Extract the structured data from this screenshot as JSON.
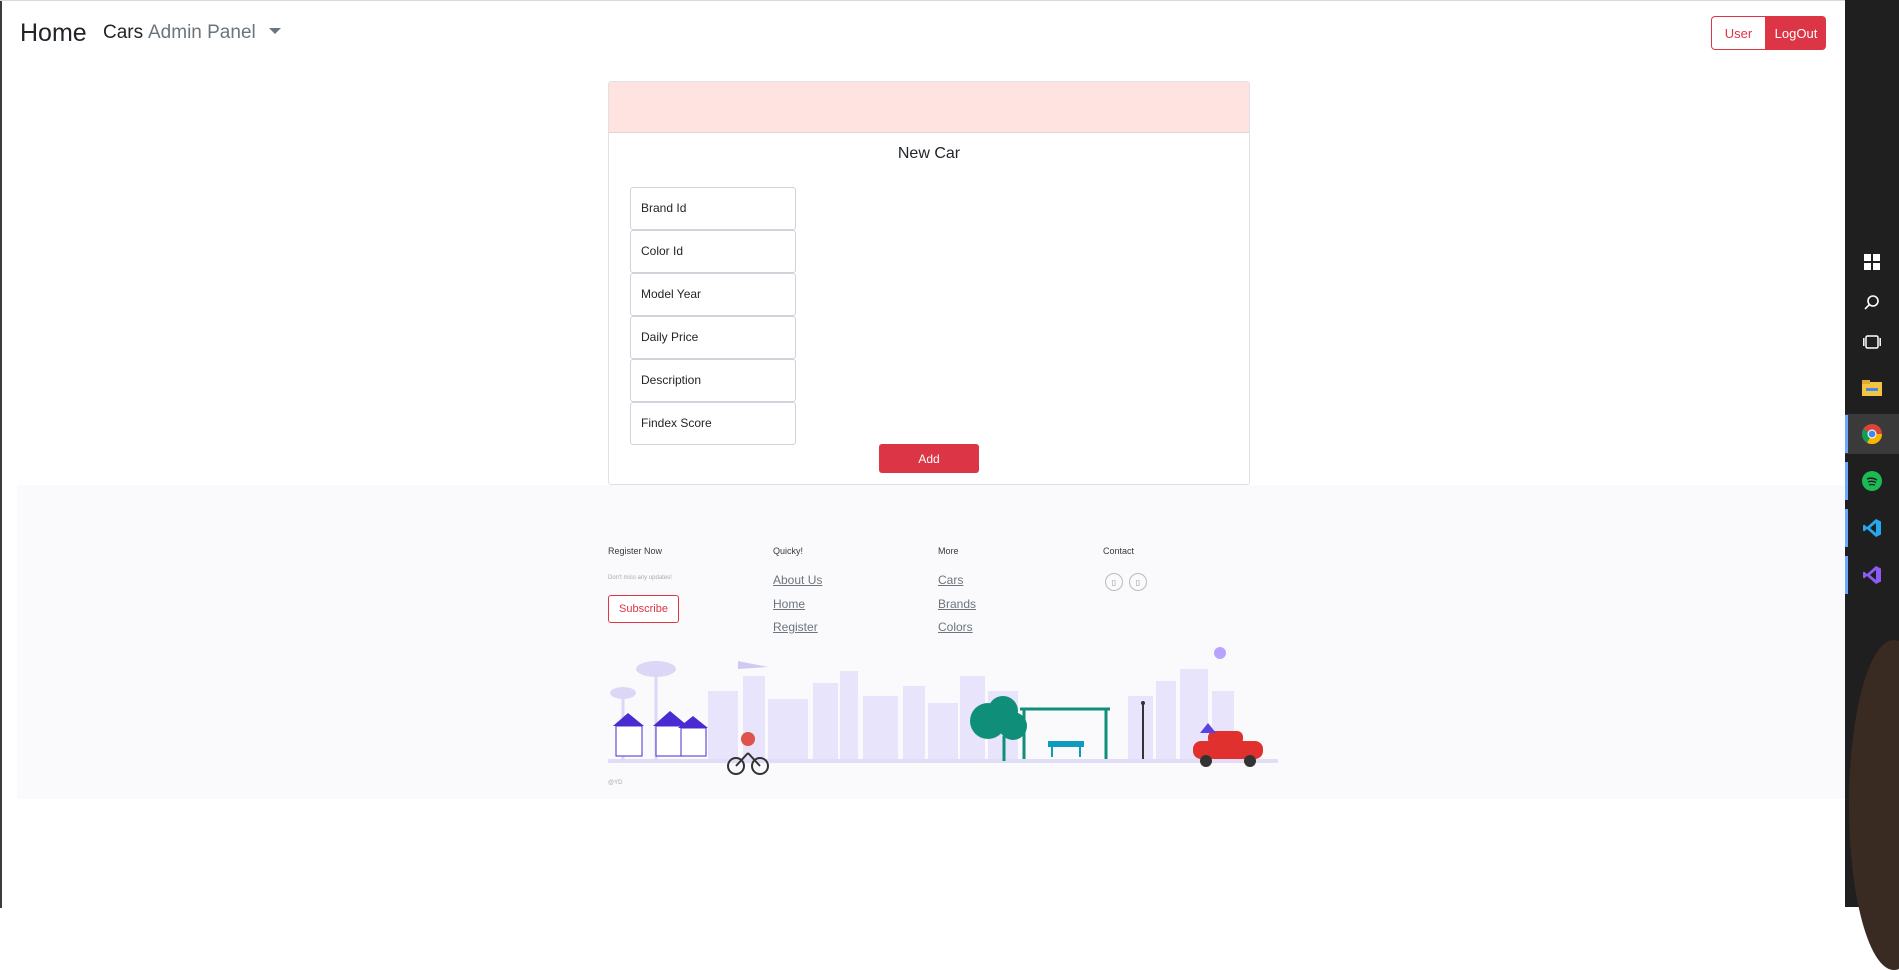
{
  "navbar": {
    "brand": "Home",
    "cars": "Cars",
    "admin_panel": "Admin Panel",
    "user_button": "User",
    "logout_button": "LogOut"
  },
  "form": {
    "title": "New Car",
    "fields": {
      "brand_id": "Brand Id",
      "color_id": "Color Id",
      "model_year": "Model Year",
      "daily_price": "Daily Price",
      "description": "Description",
      "findex_score": "Findex Score"
    },
    "add_button": "Add"
  },
  "footer": {
    "register_title": "Register Now",
    "register_text": "Don't miss any updates!",
    "subscribe_button": "Subscribe",
    "quick_title": "Quicky!",
    "quick_links": [
      "About Us",
      "Home",
      "Register"
    ],
    "more_title": "More",
    "more_links": [
      "Cars",
      "Brands",
      "Colors"
    ],
    "contact_title": "Contact",
    "social_icons": [
      "social-icon-1",
      "social-icon-2"
    ],
    "copyright": "@YD"
  },
  "taskbar": {
    "icons": [
      "windows-start-icon",
      "search-icon",
      "task-view-icon",
      "file-explorer-icon",
      "chrome-icon",
      "spotify-icon",
      "vscode-icon",
      "visual-studio-icon"
    ]
  },
  "colors": {
    "primary_red": "#dc3545",
    "card_header": "#ffe3e1",
    "footer_bg": "#fafafc"
  }
}
